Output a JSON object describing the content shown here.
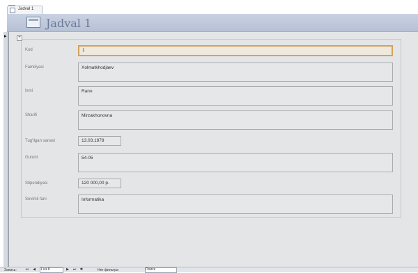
{
  "tab": {
    "label": "Jadval 1"
  },
  "form": {
    "title": "Jadval 1"
  },
  "fields": [
    {
      "label": "Kod",
      "value": "1"
    },
    {
      "label": "Familiyasi",
      "value": "Xolmatkhodjaev"
    },
    {
      "label": "Ismi",
      "value": "Rano"
    },
    {
      "label": "Sharifi",
      "value": "Mirzakhonovna"
    },
    {
      "label": "Tug'ilgan sanasi",
      "value": "13.03.1978"
    },
    {
      "label": "Guruhi",
      "value": "54-05"
    },
    {
      "label": "Stipendiyasi",
      "value": "120 000,00 p."
    },
    {
      "label": "Sevimli fani",
      "value": "Informatika"
    }
  ],
  "nav": {
    "record_label": "Запись:",
    "current": "1 из 8",
    "filter_label": "Нет фильтра",
    "search_placeholder": "Поиск"
  }
}
